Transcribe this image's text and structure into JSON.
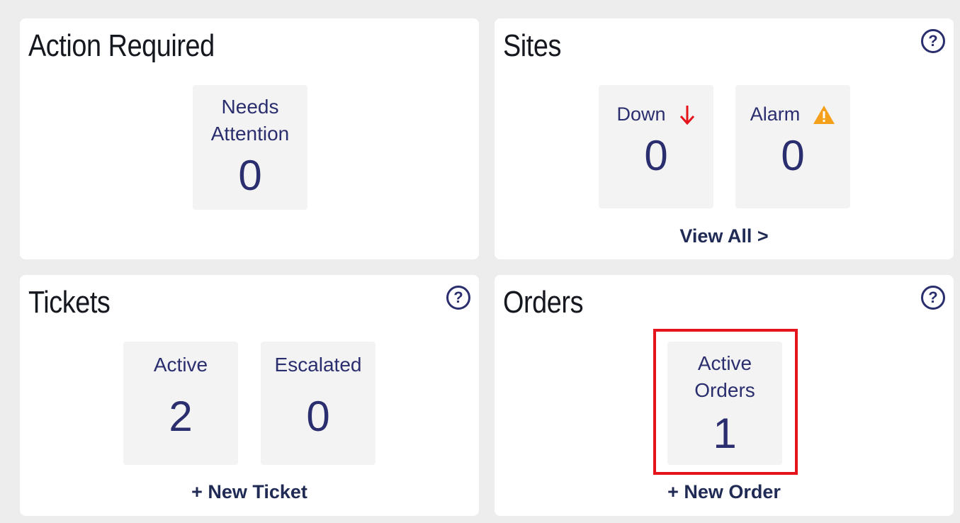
{
  "action_required": {
    "title": "Action Required",
    "needs_attention_label_1": "Needs",
    "needs_attention_label_2": "Attention",
    "needs_attention_value": "0"
  },
  "sites": {
    "title": "Sites",
    "help_label": "?",
    "down_label": "Down",
    "down_value": "0",
    "down_icon": "arrow-down-icon",
    "alarm_label": "Alarm",
    "alarm_value": "0",
    "alarm_icon": "warning-icon",
    "view_all": "View All >"
  },
  "tickets": {
    "title": "Tickets",
    "help_label": "?",
    "active_label": "Active",
    "active_value": "2",
    "escalated_label": "Escalated",
    "escalated_value": "0",
    "new_ticket": "+ New Ticket"
  },
  "orders": {
    "title": "Orders",
    "help_label": "?",
    "active_orders_label_1": "Active",
    "active_orders_label_2": "Orders",
    "active_orders_value": "1",
    "new_order": "+ New Order"
  },
  "colors": {
    "accent": "#2b2e6e",
    "down": "#e5131b",
    "alarm": "#f5a01a",
    "highlight": "#e5131b"
  }
}
